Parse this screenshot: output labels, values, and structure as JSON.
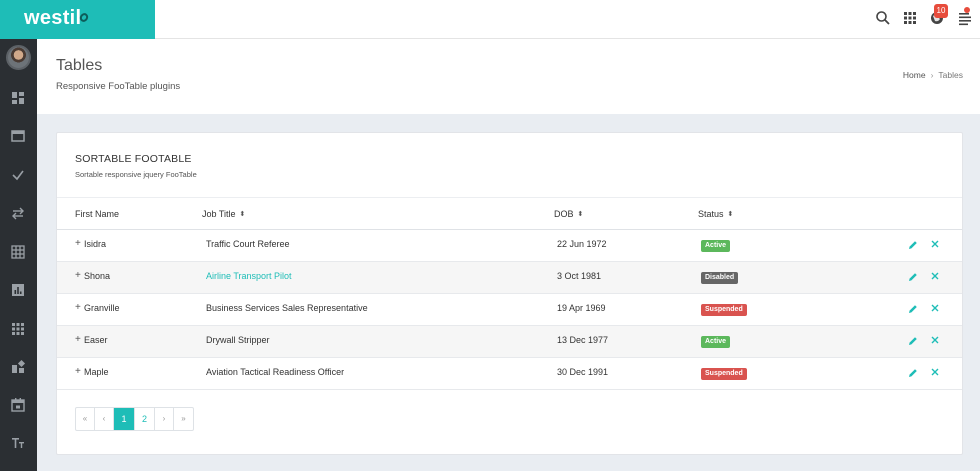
{
  "brand": {
    "name": "westil"
  },
  "header": {
    "notification_count": "10"
  },
  "page": {
    "title": "Tables",
    "subtitle": "Responsive FooTable plugins",
    "breadcrumb": {
      "home": "Home",
      "separator": "›",
      "current": "Tables"
    }
  },
  "card": {
    "title": "SORTABLE FOOTABLE",
    "subtitle": "Sortable responsive jquery FooTable"
  },
  "table": {
    "columns": [
      "First Name",
      "Job Title",
      "DOB",
      "Status"
    ],
    "sort_glyph": "⬍",
    "expander_glyph": "+",
    "rows": [
      {
        "first_name": "Isidra",
        "job_title": "Traffic Court Referee",
        "dob": "22 Jun 1972",
        "status": "Active"
      },
      {
        "first_name": "Shona",
        "job_title": "Airline Transport Pilot",
        "dob": "3 Oct 1981",
        "status": "Disabled"
      },
      {
        "first_name": "Granville",
        "job_title": "Business Services Sales Representative",
        "dob": "19 Apr 1969",
        "status": "Suspended"
      },
      {
        "first_name": "Easer",
        "job_title": "Drywall Stripper",
        "dob": "13 Dec 1977",
        "status": "Active"
      },
      {
        "first_name": "Maple",
        "job_title": "Aviation Tactical Readiness Officer",
        "dob": "30 Dec 1991",
        "status": "Suspended"
      }
    ]
  },
  "pagination": {
    "first": "«",
    "prev": "‹",
    "pages": [
      "1",
      "2"
    ],
    "next": "›",
    "last": "»",
    "current": "1"
  },
  "colors": {
    "accent": "#1ebdb7",
    "sidebar": "#2b2f33",
    "status_active": "#5cb85c",
    "status_disabled": "#666666",
    "status_suspended": "#d9534f"
  },
  "icons": {
    "top": [
      "search-icon",
      "apps-grid-icon",
      "globe-icon",
      "menu-lines-icon"
    ],
    "sidebar": [
      "dashboard-icon",
      "window-icon",
      "check-icon",
      "swap-icon",
      "table-icon",
      "chart-icon",
      "grid-icon",
      "widgets-icon",
      "calendar-icon",
      "text-size-icon"
    ],
    "row_actions": [
      "edit-pencil-icon",
      "delete-x-icon"
    ]
  }
}
